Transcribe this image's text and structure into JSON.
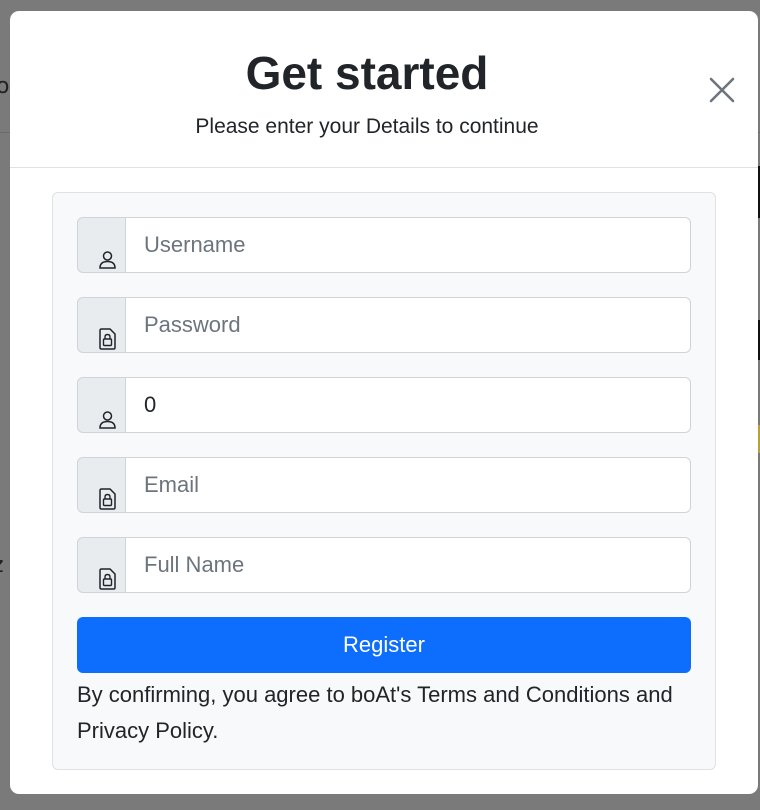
{
  "background": {
    "glyphs": [
      "o",
      "r",
      "z",
      "l"
    ]
  },
  "modal": {
    "title": "Get started",
    "subtitle": "Please enter your Details to continue",
    "close_icon": "close-icon"
  },
  "form": {
    "fields": [
      {
        "icon": "person-icon",
        "value": "",
        "placeholder": "Username"
      },
      {
        "icon": "lock-file-icon",
        "value": "",
        "placeholder": "Password"
      },
      {
        "icon": "person-icon",
        "value": "0",
        "placeholder": ""
      },
      {
        "icon": "lock-file-icon",
        "value": "",
        "placeholder": "Email"
      },
      {
        "icon": "lock-file-icon",
        "value": "",
        "placeholder": "Full Name"
      }
    ],
    "register_label": "Register",
    "terms_text": "By confirming, you agree to boAt's Terms and Conditions and Privacy Policy."
  },
  "colors": {
    "primary": "#0d6efd",
    "card_background": "#f8f9fa",
    "addon_background": "#e9ecef"
  }
}
